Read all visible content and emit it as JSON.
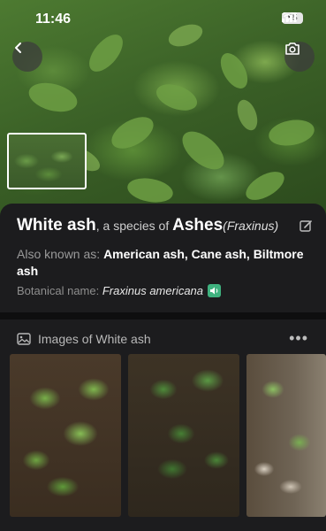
{
  "status_bar": {
    "time": "11:46",
    "battery": "85"
  },
  "icons": {
    "back": "chevron-left-icon",
    "camera": "camera-icon",
    "edit": "edit-icon",
    "sound": "speaker-icon",
    "gallery": "image-icon",
    "more": "more-icon"
  },
  "plant": {
    "common_name": "White ash",
    "species_prefix": ", a species of",
    "genus_common": "Ashes",
    "genus_latin": "(Fraxinus)",
    "aka_label": "Also known as:",
    "aka_names": "American ash, Cane ash, Biltmore ash",
    "botanical_label": "Botanical name:",
    "botanical_name": "Fraxinus americana"
  },
  "images_section": {
    "title": "Images of White ash",
    "more_label": "•••"
  },
  "colors": {
    "background": "#1c1c1e",
    "sound_badge": "#3fb27f"
  }
}
